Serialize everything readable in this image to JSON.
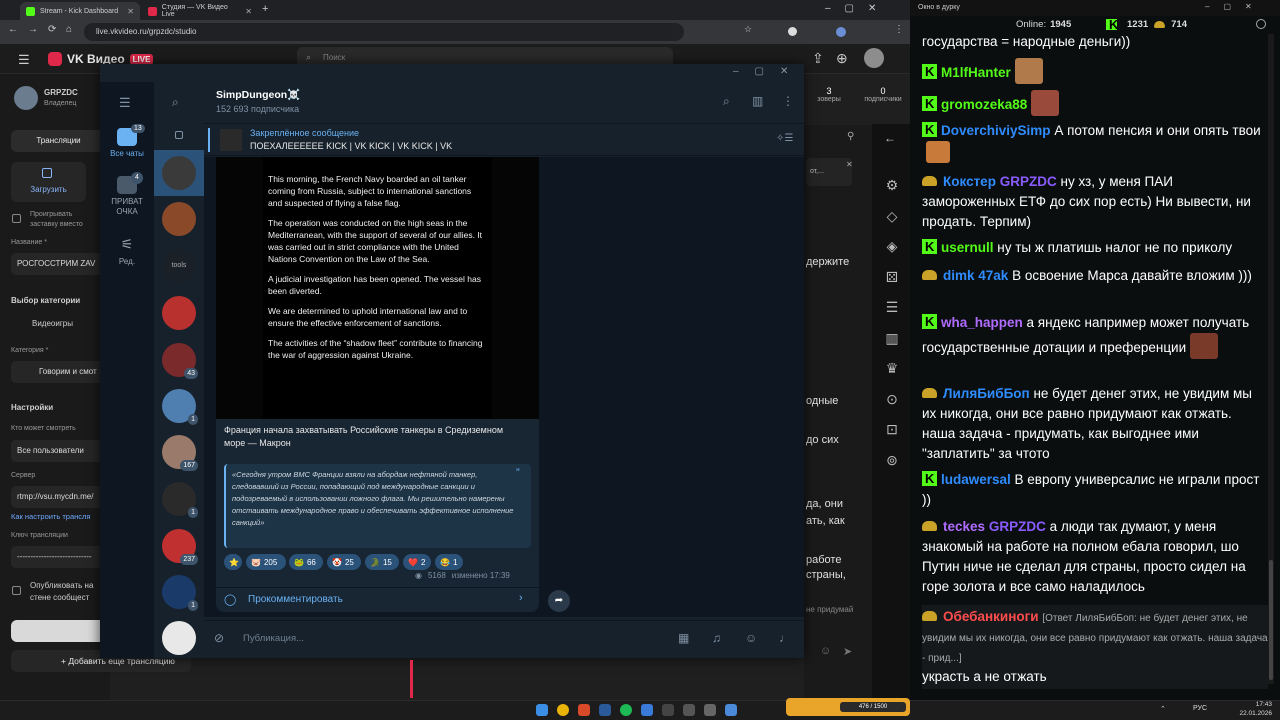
{
  "browser": {
    "tabs": [
      {
        "label": "Stream - Kick Dashboard",
        "color": "#53fc18"
      },
      {
        "label": "Студия — VK Видео Live",
        "color": "#e0294a"
      }
    ],
    "url": "live.vkvideo.ru/grpzdc/studio"
  },
  "vk": {
    "logo": "VK Видео",
    "live_badge": "LIVE",
    "search_placeholder": "Поиск",
    "profile_name": "GRPZDC",
    "profile_role": "Владелец",
    "stat1_value": "3",
    "stat1_label": "зоверы",
    "stat2_value": "0",
    "stat2_label": "подписчики",
    "nav_streams": "Трансляции",
    "upload_label": "Загрузить",
    "loop_label": "Проигрывать заставку вместо обложки",
    "name_label": "Название *",
    "name_value": "РОСГОССТРИМ ZAV",
    "category_section": "Выбор категории",
    "videogames": "Видеоигры",
    "category_label": "Категория *",
    "category_value": "Говорим и смот",
    "settings": "Настройки",
    "who_watch": "Кто может смотреть",
    "who_watch_value": "Все пользователи",
    "server": "Сервер",
    "server_value": "rtmp://vsu.mycdn.me/",
    "howto": "Как настроить трансля",
    "key_label": "Ключ трансляции",
    "key_value": "----------------------------",
    "publish_label": "Опубликовать на стене сообщест",
    "add_stream": "Добавить еще трансляцию",
    "frag_hold": "держите",
    "frag_1": "одные",
    "frag_2": "до сих",
    "frag_3": "да, они",
    "frag_4": "ать, как",
    "frag_5": "работе",
    "frag_6": "страны,",
    "frag_7": "не придумай",
    "frag_top": "от,..."
  },
  "telegram": {
    "folders": [
      {
        "label": "Все чаты",
        "badge": "13"
      },
      {
        "label": "ПРИВАТ ОЧКА",
        "badge": "4"
      },
      {
        "label": "Ред.",
        "badge": ""
      }
    ],
    "chat_badges": [
      "",
      "",
      "",
      "",
      "43",
      "1",
      "167",
      "1",
      "237",
      "1",
      ""
    ],
    "channel_name": "SimpDungeon☠️",
    "subscribers": "152 693 подписчика",
    "pinned_title": "Закреплённое сообщение",
    "pinned_text": "ПОЕХАЛЕЕЕЕЕЕ  KICK | VK KICK | VK KICK | VK",
    "news_paragraphs": [
      "This morning, the French Navy boarded an oil tanker coming from Russia, subject to international sanctions and suspected of flying a false flag.",
      "The operation was conducted on the high seas in the Mediterranean, with the support of several of our allies. It was carried out in strict compliance with the United Nations Convention on the Law of the Sea.",
      "A judicial investigation has been opened. The vessel has been diverted.",
      "We are determined to uphold international law and to ensure the effective enforcement of sanctions.",
      "The activities of the “shadow fleet” contribute to financing the war of aggression against Ukraine."
    ],
    "caption": "Франция начала захватывать Российские танкеры в Средиземном море — Макрон",
    "quote": "«Сегодня утром ВМС Франции взяли на абордаж нефтяной танкер, следовавший из России, попадающий под международные санкции и подозреваемый в использовании ложного флага. Мы решительно намерены отстаивать международное право и обеспечивать эффективное исполнение санкций»",
    "reactions": [
      {
        "emoji": "⭐",
        "count": ""
      },
      {
        "emoji": "🐷",
        "count": "205"
      },
      {
        "emoji": "🐸",
        "count": "66"
      },
      {
        "emoji": "🤡",
        "count": "25"
      },
      {
        "emoji": "🐊",
        "count": "15"
      },
      {
        "emoji": "❤️",
        "count": "2"
      },
      {
        "emoji": "😂",
        "count": "1"
      }
    ],
    "views": "5168",
    "edited": "изменено 17:39",
    "comment_label": "Прокомментировать",
    "compose_placeholder": "Публикация..."
  },
  "kick": {
    "window_title": "Окно в дурку",
    "online_label": "Online:",
    "online_value": "1945",
    "count1": "1231",
    "count2": "714",
    "messages": [
      {
        "user": "",
        "color": "#ffffff",
        "text": "государства = народные деньги))"
      },
      {
        "user": "M1lfHanter",
        "color": "#53fc18",
        "text": ""
      },
      {
        "user": "gromozeka88",
        "color": "#53fc18",
        "text": ""
      },
      {
        "user": "DoverchiviySimp",
        "color": "#2f8cff",
        "text": "А потом пенсия и они опять твои"
      },
      {
        "user": "Кокстер",
        "color": "#2f8cff",
        "text": "ну хз, у меня ПАИ замороженных ЕТФ  до сих пор есть) Ни вывести, ни продать. Терпим)",
        "mention": "GRPZDC"
      },
      {
        "user": "usernull",
        "color": "#53fc18",
        "text": "ну ты ж платишь налог не по приколу"
      },
      {
        "user": "dimk 47ak",
        "color": "#2f8cff",
        "text": "В освоение Марса давайте вложим )))"
      },
      {
        "user": "wha_happen",
        "color": "#b06cff",
        "text": "а яндекс например может получать государственные дотации и преференции"
      },
      {
        "user": "ЛиляБибБоп",
        "color": "#2f8cff",
        "text": "не будет денег этих, не увидим мы их никогда, они все равно придумают как отжать. наша задача - придумать, как выгоднее ими \"заплатить\" за чтото"
      },
      {
        "user": "ludawersal",
        "color": "#2f8cff",
        "text": "В европу универсалис не играли прост ))"
      },
      {
        "user": "teckes",
        "color": "#b06cff",
        "text": "а люди так думают, у меня знакомый на работе на полном ебала говорил, шо Путин ниче не сделал для страны, просто сидел на горе золота и все само наладилось",
        "mention": "GRPZDC"
      },
      {
        "user": "Обебанкиноги",
        "color": "#ff4d4d",
        "reply": "[Ответ ЛиляБибБоп: не будет денег этих, не увидим мы их никогда, они все равно придумают как отжать. наша задача - прид...]",
        "text": "украсть а не отжать"
      }
    ]
  },
  "taskbar": {
    "time": "17:43",
    "date": "22.01.2026",
    "lang": "РУС",
    "hud": "476 / 1500"
  }
}
